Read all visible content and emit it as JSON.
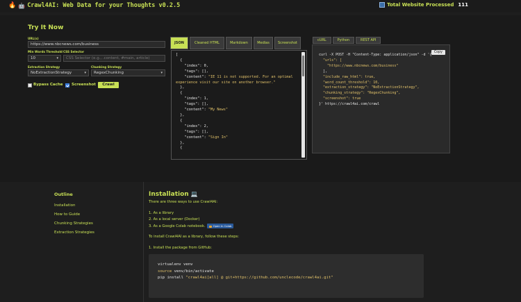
{
  "header": {
    "brand_title": "Crawl4AI: Web Data for your Thoughts v0.2.5",
    "brand_icons": [
      "fire-icon",
      "robot-icon"
    ],
    "totals_label": "Total Website Processed",
    "totals_count": "111",
    "totals_icon": "bar-chart-icon"
  },
  "form": {
    "title": "Try It Now",
    "url_label": "URL(s)",
    "url_value": "https://www.nbcnews.com/business",
    "min_words_label": "Min Words Threshold",
    "min_words_value": "10",
    "css_selector_label": "CSS Selector",
    "css_selector_placeholder": "CSS Selector (e.g., .content, #main, article)",
    "extraction_label": "Extraction Strategy",
    "extraction_value": "NoExtractionStrategy",
    "chunking_label": "Chunking Strategy",
    "chunking_value": "RegexChunking",
    "bypass_cache_label": "Bypass Cache",
    "bypass_cache_checked": false,
    "screenshot_label": "Screenshot",
    "screenshot_checked": true,
    "crawl_label": "Crawl"
  },
  "result_tabs": [
    {
      "label": "JSON",
      "active": true
    },
    {
      "label": "Cleaned HTML",
      "active": false
    },
    {
      "label": "Markdown",
      "active": false
    },
    {
      "label": "Medias",
      "active": false
    },
    {
      "label": "Screenshot",
      "active": false
    }
  ],
  "code_tabs": [
    {
      "label": "cURL"
    },
    {
      "label": "Python"
    },
    {
      "label": "REST API"
    }
  ],
  "copy_label": "Copy",
  "result_items": [
    {
      "index": 0,
      "content": "IE 11 is not supported. For an optimal experience visit our site on another browser."
    },
    {
      "index": 1,
      "content": "My News"
    },
    {
      "index": 2,
      "content": "Sign In"
    }
  ],
  "curl": {
    "command": "curl -X POST -H \"Content-Type: application/json\" -d '{",
    "urls_key": "\"urls\": [",
    "url": "\"https://www.nbcnews.com/business\"",
    "close_urls": "],",
    "include_raw_html": "\"include_raw_html\": true,",
    "word_count_threshold": "\"word_count_threshold\": 10,",
    "extraction_strategy": "\"extraction_strategy\": \"NoExtractionStrategy\",",
    "chunking_strategy": "\"chunking_strategy\": \"RegexChunking\",",
    "screenshot": "\"screenshot\": true",
    "endpoint": "}' https://crawl4ai.com/crawl"
  },
  "outline": {
    "title": "Outline",
    "links": [
      "Installation",
      "How to Guide",
      "Chunking Strategies",
      "Extraction Strategies"
    ]
  },
  "installation": {
    "title": "Installation",
    "title_icon": "laptop-icon",
    "intro": "There are three ways to use Crawl4AI:",
    "ways": [
      "1. As a library",
      "2. As a local server (Docker)",
      "3. As a Google Colab notebook."
    ],
    "colab_badge": "Open In Colab",
    "library_intro": "To install Crawl4AI as a library, follow these steps:",
    "step1": "1. Install the package from GitHub:",
    "code": {
      "line1": "virtualenv venv",
      "line2_kw": "source",
      "line2_rest": " venv/bin/activate",
      "line3_cmd": "pip install ",
      "line3_str": "\"crawl4ai[all] @ git+https://github.com/unclecode/crawl4ai.git\""
    }
  },
  "colors": {
    "accent": "#c8e055",
    "background": "#1e1e1e",
    "string": "#e2c26a"
  }
}
